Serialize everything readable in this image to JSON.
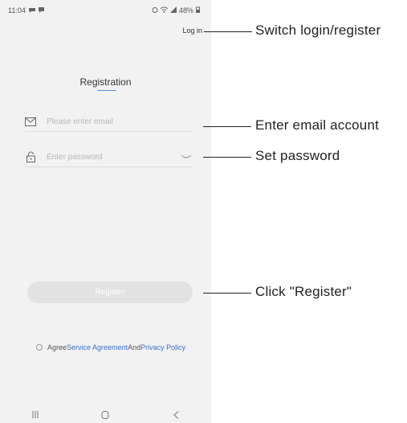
{
  "status_bar": {
    "time": "11:04",
    "battery": "48%"
  },
  "header": {
    "login_link": "Log in"
  },
  "page": {
    "title": "Registration"
  },
  "form": {
    "email_placeholder": "Please enter email",
    "password_placeholder": "Enter password",
    "register_label": "Register",
    "agree_text": "Agree",
    "service_agreement": "Service Agreement",
    "and_text": "And",
    "privacy_policy": "Privacy Policy"
  },
  "annotations": {
    "switch_login": "Switch login/register",
    "email_account": "Enter email account",
    "set_password": "Set password",
    "click_register": "Click \"Register\""
  },
  "colors": {
    "screen_bg": "#f2f2f2",
    "link": "#3a6fc4",
    "button_disabled": "#e2e2e2"
  },
  "icons": [
    "message-icon",
    "chat-icon",
    "alarm-icon",
    "wifi-icon",
    "signal-icon",
    "battery-icon",
    "envelope-icon",
    "lock-icon",
    "eye-closed-icon",
    "recent-apps-icon",
    "home-icon",
    "back-icon"
  ]
}
